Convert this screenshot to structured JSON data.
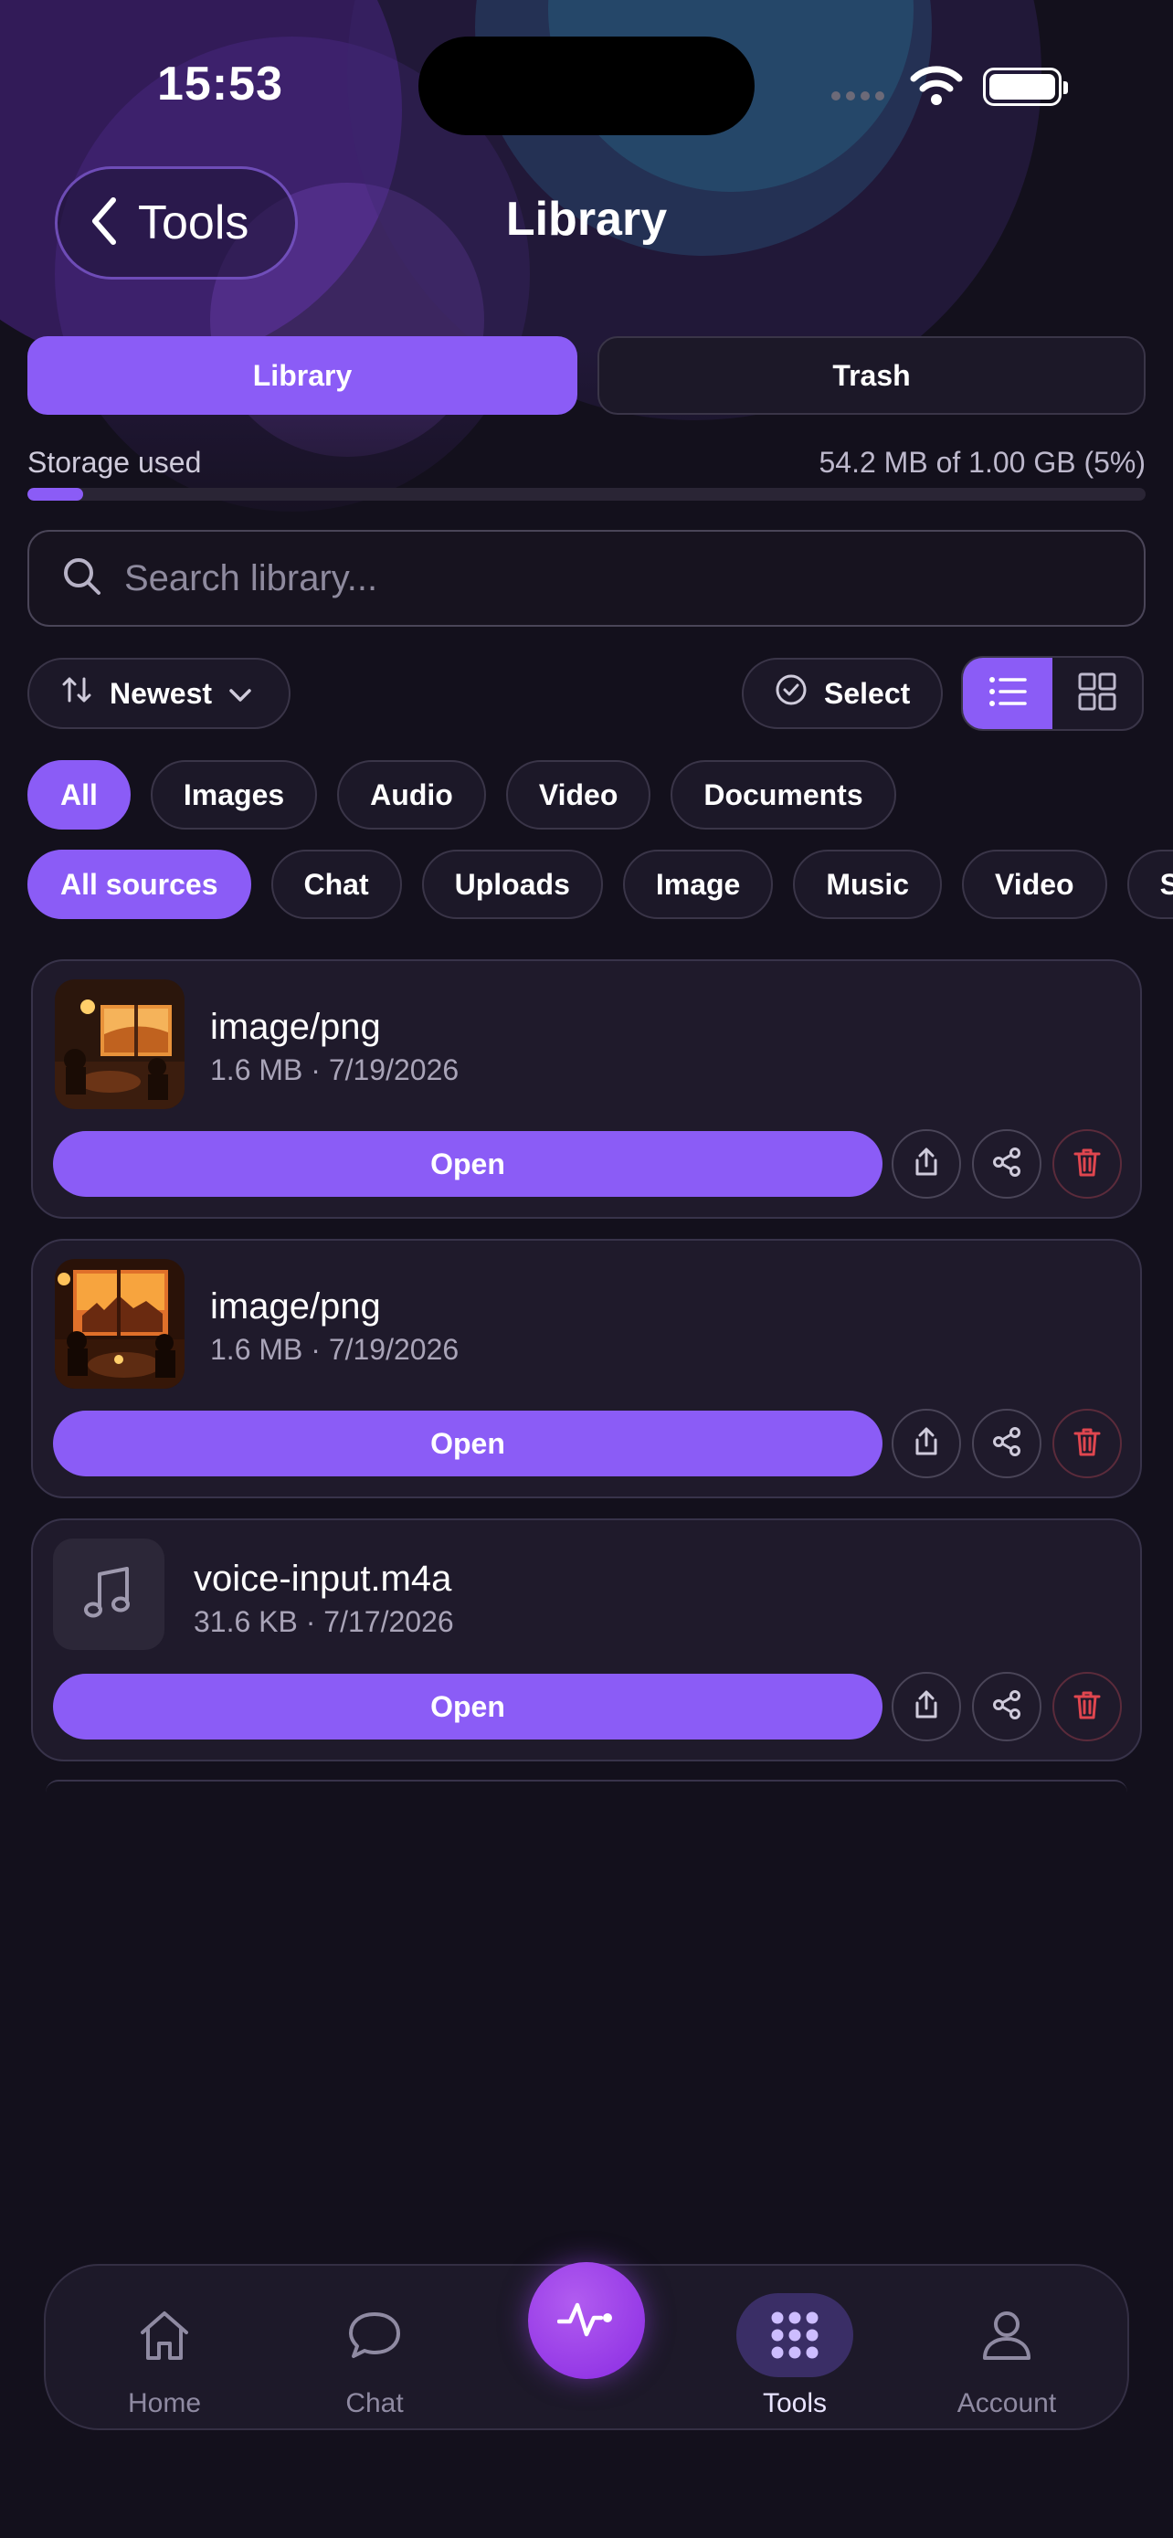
{
  "status_bar": {
    "time": "15:53"
  },
  "header": {
    "back_label": "Tools",
    "title": "Library"
  },
  "segments": {
    "library": "Library",
    "trash": "Trash"
  },
  "storage": {
    "label": "Storage used",
    "value": "54.2 MB of 1.00 GB (5%)",
    "fraction": 0.05
  },
  "search": {
    "placeholder": "Search library..."
  },
  "toolbar": {
    "sort_label": "Newest",
    "select_label": "Select",
    "view_mode": "list"
  },
  "type_filters": [
    "All",
    "Images",
    "Audio",
    "Video",
    "Documents"
  ],
  "source_filters": [
    "All sources",
    "Chat",
    "Uploads",
    "Image",
    "Music",
    "Video",
    "S"
  ],
  "items": [
    {
      "name": "image/png",
      "meta": "1.6 MB · 7/19/2026",
      "kind": "image",
      "open_label": "Open"
    },
    {
      "name": "image/png",
      "meta": "1.6 MB · 7/19/2026",
      "kind": "image",
      "open_label": "Open"
    },
    {
      "name": "voice-input.m4a",
      "meta": "31.6 KB · 7/17/2026",
      "kind": "audio",
      "open_label": "Open"
    }
  ],
  "tabbar": {
    "home": "Home",
    "chat": "Chat",
    "tools": "Tools",
    "account": "Account",
    "active": "tools"
  },
  "colors": {
    "accent": "#8b5cf6",
    "background": "#13101c",
    "danger": "#e0464f"
  }
}
